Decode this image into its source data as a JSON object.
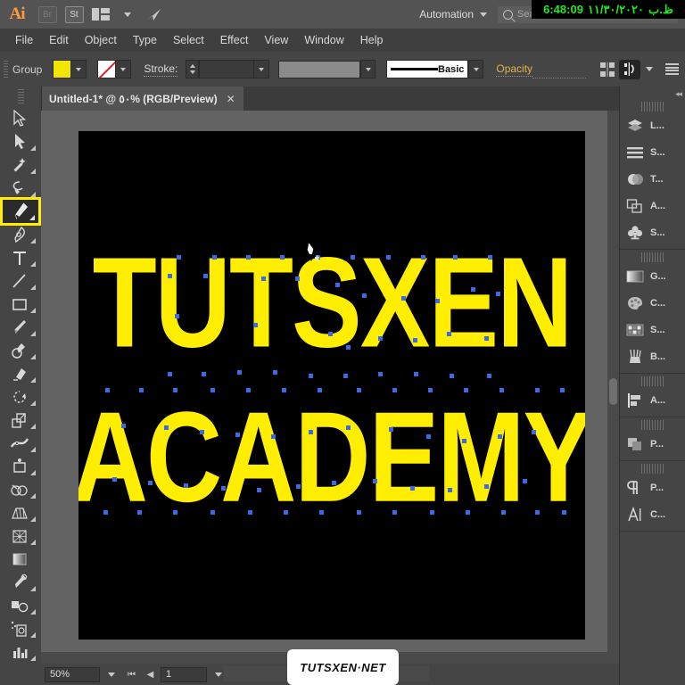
{
  "app": {
    "name": "Adobe Illustrator",
    "logo_text": "Ai",
    "bridge_label": "Br",
    "stock_label": "St",
    "automation_label": "Automation",
    "search_placeholder": "Search Adobe Stock"
  },
  "clock_overlay": {
    "time": "6:48:09",
    "date": "١١/٣٠/٢٠٢٠",
    "meridiem": "ظ.ب",
    "color": "#25e825",
    "background": "#000000"
  },
  "menubar": {
    "items": [
      "File",
      "Edit",
      "Object",
      "Type",
      "Select",
      "Effect",
      "View",
      "Window",
      "Help"
    ]
  },
  "controlbar": {
    "selection_label": "Group",
    "fill_color": "#f2e600",
    "stroke_swatch": "none",
    "stroke_label": "Stroke:",
    "stroke_weight": "",
    "brush_name": "Basic",
    "opacity_label": "Opacity",
    "opacity_value": "",
    "opacity_color": "#e2b24a"
  },
  "document_tab": {
    "title": "Untitled-1* @ ٥٠% (RGB/Preview)",
    "close_label": "✕"
  },
  "toolbar": {
    "tools": [
      {
        "name": "selection-tool",
        "selected": false
      },
      {
        "name": "direct-selection-tool",
        "selected": false
      },
      {
        "name": "magic-wand-tool",
        "selected": false
      },
      {
        "name": "lasso-tool",
        "selected": false
      },
      {
        "name": "pen-tool",
        "selected": true
      },
      {
        "name": "curvature-tool",
        "selected": false
      },
      {
        "name": "type-tool",
        "selected": false
      },
      {
        "name": "line-segment-tool",
        "selected": false
      },
      {
        "name": "rectangle-tool",
        "selected": false
      },
      {
        "name": "paintbrush-tool",
        "selected": false
      },
      {
        "name": "shaper-pencil-tool",
        "selected": false
      },
      {
        "name": "eraser-tool",
        "selected": false
      },
      {
        "name": "rotate-tool",
        "selected": false
      },
      {
        "name": "scale-tool",
        "selected": false
      },
      {
        "name": "width-tool",
        "selected": false
      },
      {
        "name": "free-transform-tool",
        "selected": false
      },
      {
        "name": "shape-builder-tool",
        "selected": false
      },
      {
        "name": "perspective-grid-tool",
        "selected": false
      },
      {
        "name": "mesh-tool",
        "selected": false
      },
      {
        "name": "gradient-tool",
        "selected": false
      },
      {
        "name": "eyedropper-tool",
        "selected": false
      },
      {
        "name": "blend-tool",
        "selected": false
      },
      {
        "name": "symbol-sprayer-tool",
        "selected": false
      },
      {
        "name": "column-graph-tool",
        "selected": false
      }
    ],
    "selected_tool": "pen-tool",
    "highlight_color": "#ffee00"
  },
  "artwork": {
    "line1": "TUTSXEN",
    "line2": "ACADEMY",
    "fill_color": "#ffee00",
    "background_color": "#000000",
    "anchor_color": "#3a6ae8",
    "selected": true
  },
  "statusbar": {
    "zoom_level": "50%",
    "page_number": "1",
    "first_label": "⏮",
    "prev_label": "◀",
    "next_label": "▶",
    "last_label": "⏭"
  },
  "right_panel": {
    "groups": [
      {
        "items": [
          {
            "icon": "layers-icon",
            "label": "L...",
            "full": "Layers"
          },
          {
            "icon": "stroke-lines-icon",
            "label": "S...",
            "full": "Stroke"
          },
          {
            "icon": "transparency-icon",
            "label": "T...",
            "full": "Transparency"
          },
          {
            "icon": "artboards-icon",
            "label": "A...",
            "full": "Artboards"
          },
          {
            "icon": "symbols-icon",
            "label": "S...",
            "full": "Symbols"
          }
        ]
      },
      {
        "items": [
          {
            "icon": "gradient-icon",
            "label": "G...",
            "full": "Gradient"
          },
          {
            "icon": "color-palette-icon",
            "label": "C...",
            "full": "Color"
          },
          {
            "icon": "swatches-icon",
            "label": "S...",
            "full": "Swatches"
          },
          {
            "icon": "brushes-icon",
            "label": "B...",
            "full": "Brushes"
          }
        ]
      },
      {
        "items": [
          {
            "icon": "align-icon",
            "label": "A...",
            "full": "Align"
          }
        ]
      },
      {
        "items": [
          {
            "icon": "pathfinder-icon",
            "label": "P...",
            "full": "Pathfinder"
          }
        ]
      },
      {
        "items": [
          {
            "icon": "paragraph-icon",
            "label": "P...",
            "full": "Paragraph"
          },
          {
            "icon": "character-icon",
            "label": "C...",
            "full": "Character"
          }
        ]
      }
    ]
  },
  "watermark": {
    "text": "TUTSXEN·NET"
  }
}
